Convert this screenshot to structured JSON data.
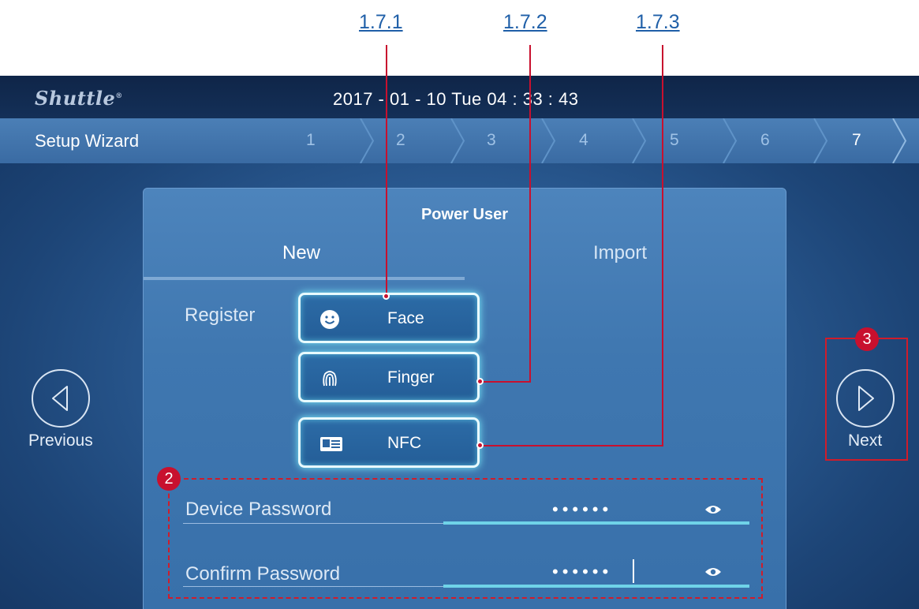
{
  "callouts": {
    "ref_1": "1.7.1",
    "ref_2": "1.7.2",
    "ref_3": "1.7.3",
    "badge_2": "2",
    "badge_3": "3",
    "color": "#c8102e"
  },
  "header": {
    "logo": "Shuttle",
    "logo_mark": "®",
    "clock": "2017 - 01 - 10   Tue   04 : 33 : 43"
  },
  "wizard": {
    "title": "Setup Wizard",
    "steps": [
      "1",
      "2",
      "3",
      "4",
      "5",
      "6",
      "7"
    ],
    "active_step": "7"
  },
  "panel": {
    "title": "Power User",
    "tabs": [
      "New",
      "Import"
    ],
    "active_tab": "New",
    "register_label": "Register",
    "register_buttons": [
      {
        "label": "Face",
        "icon": "smiley-face-icon"
      },
      {
        "label": "Finger",
        "icon": "fingerprint-icon"
      },
      {
        "label": "NFC",
        "icon": "id-card-icon"
      }
    ],
    "fields": [
      {
        "label": "Device Password",
        "value": "••••••",
        "icon": "eye-icon"
      },
      {
        "label": "Confirm Password",
        "value": "••••••",
        "icon": "eye-icon"
      }
    ]
  },
  "nav": {
    "previous_label": "Previous",
    "next_label": "Next",
    "previous_icon": "triangle-left-icon",
    "next_icon": "triangle-right-icon"
  },
  "colors": {
    "accent_glow": "#7ff3ff",
    "field_bar": "#6fd3e8",
    "link": "#1f5fa8"
  }
}
